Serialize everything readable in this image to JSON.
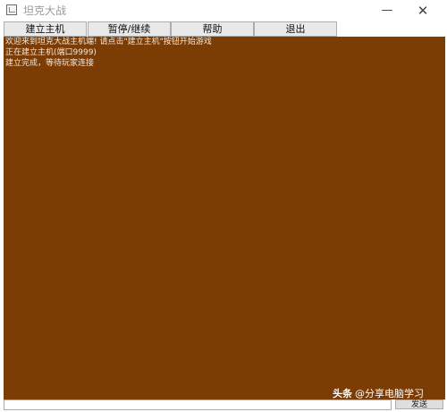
{
  "window": {
    "title": "坦克大战",
    "minimize_glyph": "—",
    "close_glyph": "✕"
  },
  "menu": {
    "items": [
      {
        "label": "建立主机"
      },
      {
        "label": "暂停/继续"
      },
      {
        "label": "帮助"
      },
      {
        "label": "退出"
      }
    ]
  },
  "game_area": {
    "background_color": "#7c3d04",
    "log": [
      "欢迎来到坦克大战主机端! 请点击\"建立主机\"按钮开始游戏",
      "正在建立主机(端口9999)",
      "建立完成，等待玩家连接"
    ]
  },
  "bottom_bar": {
    "chat_value": "",
    "send_label": "发送"
  },
  "watermark": {
    "brand": "头条",
    "handle": "@分享电脑学习"
  }
}
